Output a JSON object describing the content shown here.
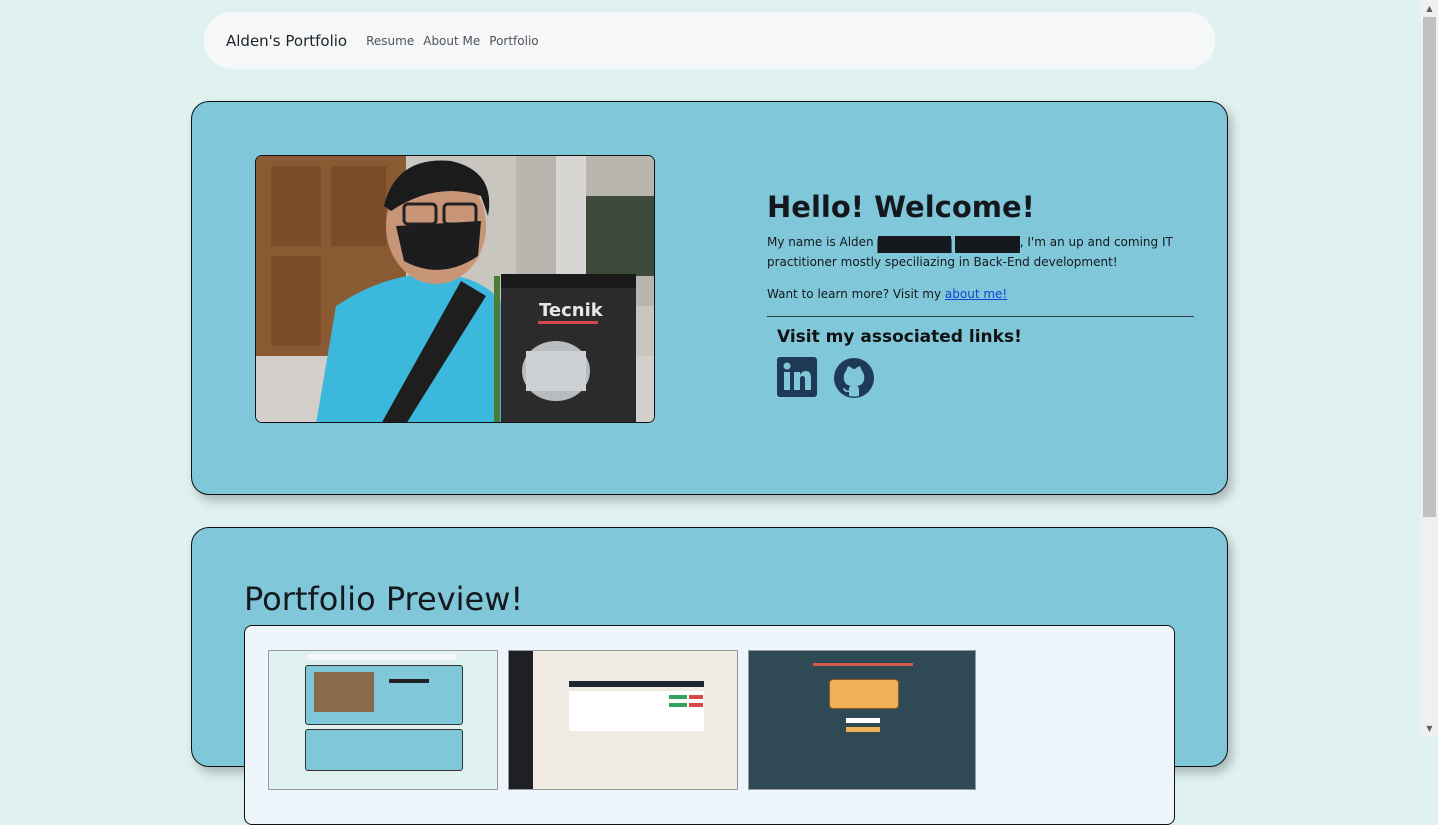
{
  "nav": {
    "brand": "Alden's Portfolio",
    "links": [
      "Resume",
      "About Me",
      "Portfolio"
    ]
  },
  "hero": {
    "title": "Hello! Welcome!",
    "intro_prefix": "My name is Alden",
    "redacted_1": "████████",
    "redacted_2": "███████",
    "intro_suffix": ", I'm an up and coming IT practitioner mostly speciliazing in Back-End development!",
    "learn_prefix": "Want to learn more? Visit my ",
    "learn_link": "about me!",
    "links_title": "Visit my associated links!",
    "social_icons": [
      "linkedin-icon",
      "github-icon"
    ]
  },
  "portfolio": {
    "title": "Portfolio Preview!"
  },
  "colors": {
    "page_bg": "#dff2f0",
    "panel_bg": "#80c7d9",
    "nav_bg": "#f5f7f8",
    "icon_color": "#1f3a56"
  }
}
